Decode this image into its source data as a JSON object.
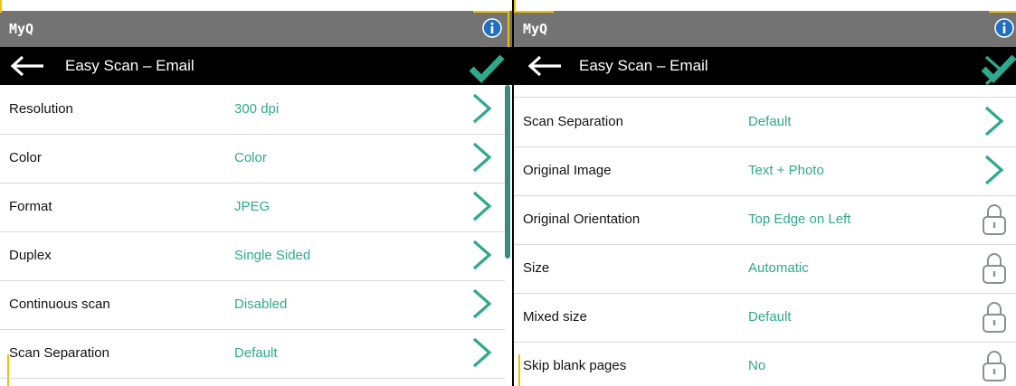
{
  "colors": {
    "accent": "#2fa98c",
    "topbar": "#737373",
    "navbar": "#000000",
    "marker": "#f2c200"
  },
  "left": {
    "brand": "MyQ",
    "title": "Easy Scan – Email",
    "icons": {
      "info": "info-icon",
      "back": "arrow-left-icon",
      "confirm": "checkmark-icon"
    },
    "rows": [
      {
        "label": "Resolution",
        "value": "300 dpi",
        "icon": "chevron-right-icon"
      },
      {
        "label": "Color",
        "value": "Color",
        "icon": "chevron-right-icon"
      },
      {
        "label": "Format",
        "value": "JPEG",
        "icon": "chevron-right-icon"
      },
      {
        "label": "Duplex",
        "value": "Single Sided",
        "icon": "chevron-right-icon"
      },
      {
        "label": "Continuous scan",
        "value": "Disabled",
        "icon": "chevron-right-icon"
      },
      {
        "label": "Scan Separation",
        "value": "Default",
        "icon": "chevron-right-icon"
      }
    ]
  },
  "right": {
    "brand": "MyQ",
    "title": "Easy Scan – Email",
    "icons": {
      "info": "info-icon",
      "back": "arrow-left-icon",
      "confirm": "checkmark-icon"
    },
    "rows": [
      {
        "label": "Scan Separation",
        "value": "Default",
        "icon": "chevron-right-icon"
      },
      {
        "label": "Original Image",
        "value": "Text + Photo",
        "icon": "chevron-right-icon"
      },
      {
        "label": "Original Orientation",
        "value": "Top Edge on Left",
        "icon": "lock-icon"
      },
      {
        "label": "Size",
        "value": "Automatic",
        "icon": "lock-icon"
      },
      {
        "label": "Mixed size",
        "value": "Default",
        "icon": "lock-icon"
      },
      {
        "label": "Skip blank pages",
        "value": "No",
        "icon": "lock-icon"
      }
    ]
  }
}
